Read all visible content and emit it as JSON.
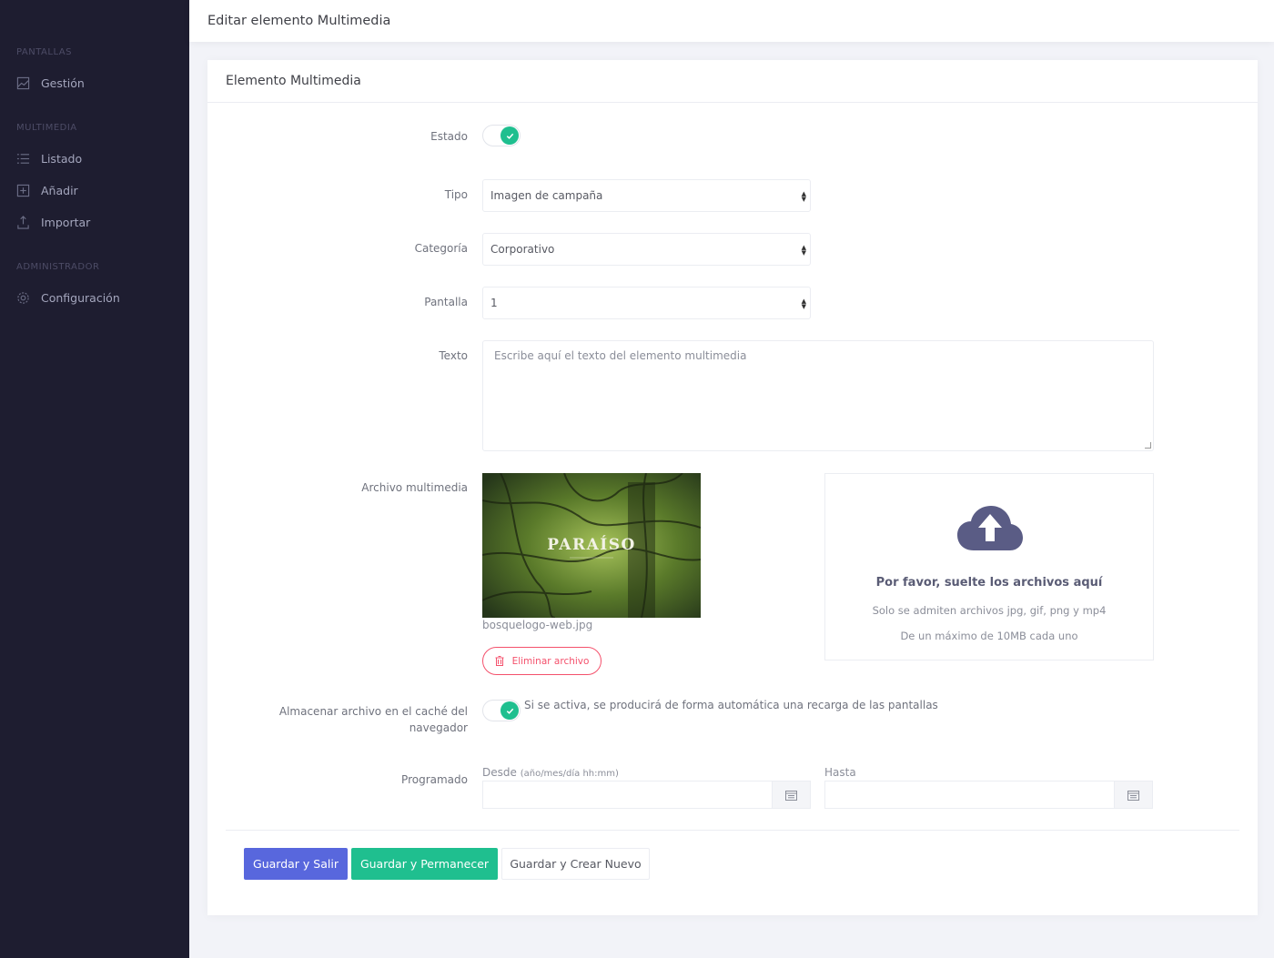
{
  "sidebar": {
    "sections": [
      {
        "title": "PANTALLAS",
        "items": [
          {
            "label": "Gestión",
            "icon": "image-icon"
          }
        ]
      },
      {
        "title": "MULTIMEDIA",
        "items": [
          {
            "label": "Listado",
            "icon": "list-icon"
          },
          {
            "label": "Añadir",
            "icon": "add-icon"
          },
          {
            "label": "Importar",
            "icon": "upload-icon"
          }
        ]
      },
      {
        "title": "ADMINISTRADOR",
        "items": [
          {
            "label": "Configuración",
            "icon": "gear-icon"
          }
        ]
      }
    ]
  },
  "header": {
    "title": "Editar elemento Multimedia"
  },
  "panel": {
    "title": "Elemento Multimedia"
  },
  "form": {
    "estado": {
      "label": "Estado",
      "on": true
    },
    "tipo": {
      "label": "Tipo",
      "value": "Imagen de campaña"
    },
    "categoria": {
      "label": "Categoría",
      "value": "Corporativo"
    },
    "pantalla": {
      "label": "Pantalla",
      "value": "1"
    },
    "texto": {
      "label": "Texto",
      "placeholder": "Escribe aquí el texto del elemento multimedia"
    },
    "archivo": {
      "label": "Archivo multimedia",
      "filename": "bosquelogo-web.jpg",
      "image_text": "PARAÍSO",
      "delete_label": "Eliminar archivo",
      "dropzone": {
        "title": "Por favor, suelte los archivos aquí",
        "formats": "Solo se admiten archivos jpg, gif, png y mp4",
        "size": "De un máximo de 10MB cada uno"
      }
    },
    "cache": {
      "label_line1": "Almacenar archivo en el caché del",
      "label_line2": "navegador",
      "on": true,
      "hint": "Si se activa, se producirá de forma automática una recarga de las pantallas"
    },
    "programado": {
      "label": "Programado",
      "desde_label": "Desde",
      "desde_format": "(año/mes/día hh:mm)",
      "hasta_label": "Hasta"
    }
  },
  "actions": {
    "save_exit": "Guardar y Salir",
    "save_stay": "Guardar y Permanecer",
    "save_new": "Guardar y Crear Nuevo"
  },
  "colors": {
    "sidebar_bg": "#1e1d30",
    "primary": "#5867dd",
    "success": "#1fbf8f",
    "danger": "#f4516c"
  }
}
